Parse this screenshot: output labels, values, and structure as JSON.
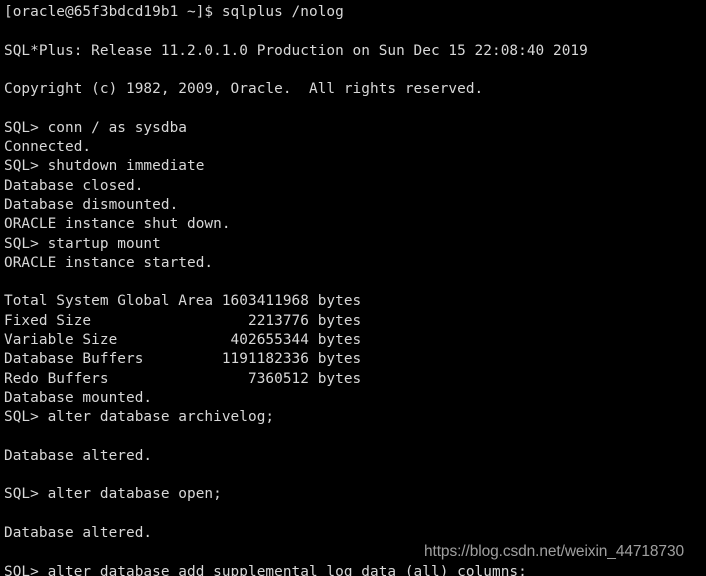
{
  "terminal": {
    "prompt_user": "oracle",
    "prompt_host": "65f3bdcd19b1",
    "sql_prompt": "SQL>",
    "background_color": "#000000",
    "foreground_color": "#d8d8d8",
    "lines": [
      "[oracle@65f3bdcd19b1 ~]$ sqlplus /nolog",
      "",
      "SQL*Plus: Release 11.2.0.1.0 Production on Sun Dec 15 22:08:40 2019",
      "",
      "Copyright (c) 1982, 2009, Oracle.  All rights reserved.",
      "",
      "SQL> conn / as sysdba",
      "Connected.",
      "SQL> shutdown immediate",
      "Database closed.",
      "Database dismounted.",
      "ORACLE instance shut down.",
      "SQL> startup mount",
      "ORACLE instance started.",
      "",
      "Total System Global Area 1603411968 bytes",
      "Fixed Size                  2213776 bytes",
      "Variable Size             402655344 bytes",
      "Database Buffers         1191182336 bytes",
      "Redo Buffers                7360512 bytes",
      "Database mounted.",
      "SQL> alter database archivelog;",
      "",
      "Database altered.",
      "",
      "SQL> alter database open;",
      "",
      "Database altered.",
      "",
      "SQL> alter database add supplemental log data (all) columns;"
    ],
    "banner": {
      "product": "SQL*Plus",
      "release": "11.2.0.1.0",
      "edition": "Production",
      "timestamp": "Sun Dec 15 22:08:40 2019",
      "copyright": "Copyright (c) 1982, 2009, Oracle.  All rights reserved."
    },
    "sga": {
      "unit": "bytes",
      "rows": [
        {
          "label": "Total System Global Area",
          "value": "1603411968"
        },
        {
          "label": "Fixed Size",
          "value": "2213776"
        },
        {
          "label": "Variable Size",
          "value": "402655344"
        },
        {
          "label": "Database Buffers",
          "value": "1191182336"
        },
        {
          "label": "Redo Buffers",
          "value": "7360512"
        }
      ]
    },
    "commands": [
      "sqlplus /nolog",
      "conn / as sysdba",
      "shutdown immediate",
      "startup mount",
      "alter database archivelog;",
      "alter database open;",
      "alter database add supplemental log data (all) columns;"
    ],
    "status_messages": [
      "Connected.",
      "Database closed.",
      "Database dismounted.",
      "ORACLE instance shut down.",
      "ORACLE instance started.",
      "Database mounted.",
      "Database altered."
    ]
  },
  "watermark": {
    "text": "https://blog.csdn.net/weixin_44718730"
  }
}
